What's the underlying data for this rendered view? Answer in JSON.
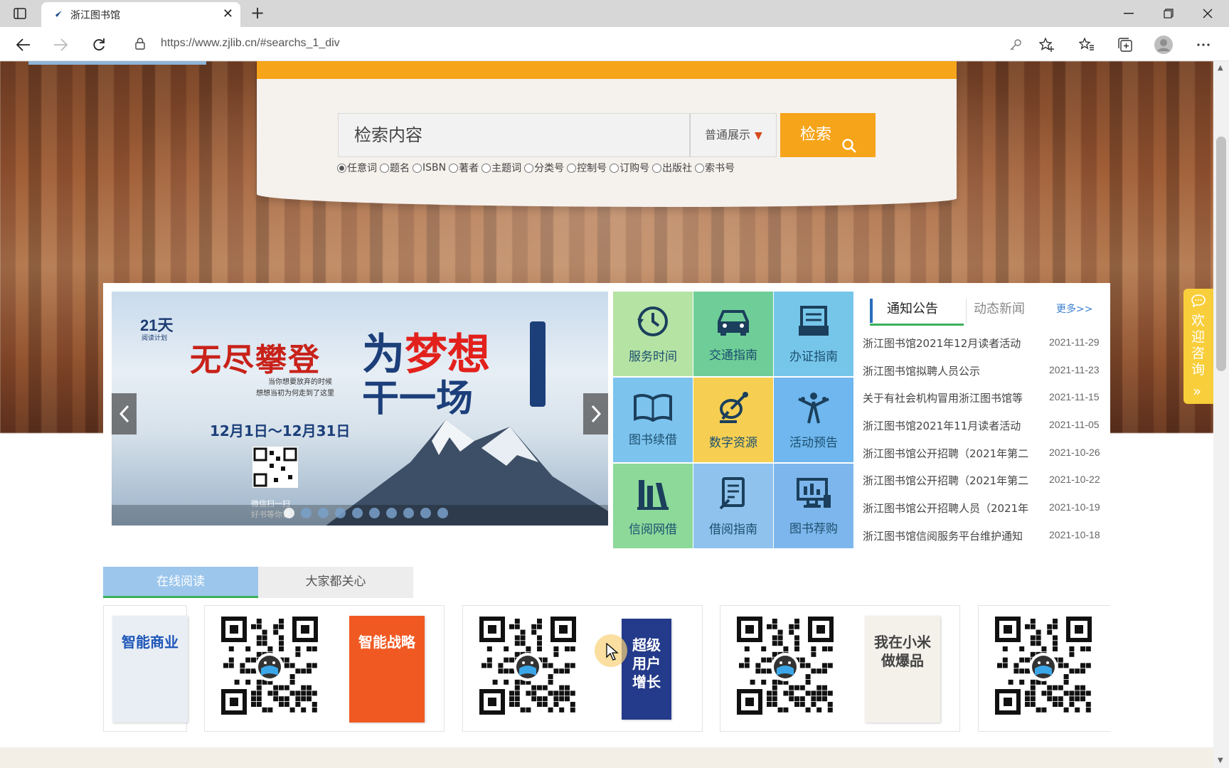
{
  "browser": {
    "tab_title": "浙江图书馆",
    "url": "https://www.zjlib.cn/#searchs_1_div",
    "tab_close": "✕",
    "new_tab": "+"
  },
  "search": {
    "placeholder": "检索内容",
    "display_mode": "普通展示",
    "button_label": "检索",
    "fields": [
      {
        "label": "任意词",
        "checked": true
      },
      {
        "label": "题名",
        "checked": false
      },
      {
        "label": "ISBN",
        "checked": false
      },
      {
        "label": "著者",
        "checked": false
      },
      {
        "label": "主题词",
        "checked": false
      },
      {
        "label": "分类号",
        "checked": false
      },
      {
        "label": "控制号",
        "checked": false
      },
      {
        "label": "订购号",
        "checked": false
      },
      {
        "label": "出版社",
        "checked": false
      },
      {
        "label": "索书号",
        "checked": false
      }
    ]
  },
  "banner": {
    "days": "21天",
    "plan": "阅读计划",
    "headline1": "无尽攀登",
    "sub1": "当你想要放弃的时候",
    "sub2": "想想当初为何走到了这里",
    "headline2a_pre": "为",
    "headline2a_accent": "梦想",
    "headline2b": "干一场",
    "date_range": "12月1日～12月31日",
    "qr_caption1": "微信扫一扫",
    "qr_caption2": "好书等你读",
    "slide_count": 10,
    "active_slide": 1
  },
  "tiles": [
    {
      "label": "服务时间",
      "icon": "clock-icon",
      "color": "#b5e3a4"
    },
    {
      "label": "交通指南",
      "icon": "car-icon",
      "color": "#6fce98"
    },
    {
      "label": "办证指南",
      "icon": "card-icon",
      "color": "#76c6ea"
    },
    {
      "label": "图书续借",
      "icon": "book-icon",
      "color": "#7cc3ee"
    },
    {
      "label": "数字资源",
      "icon": "satellite-icon",
      "color": "#f6cf52"
    },
    {
      "label": "活动预告",
      "icon": "people-icon",
      "color": "#6fb7ee"
    },
    {
      "label": "信阅网借",
      "icon": "books-icon",
      "color": "#8cd99a"
    },
    {
      "label": "借阅指南",
      "icon": "document-icon",
      "color": "#8fc3ee"
    },
    {
      "label": "图书荐购",
      "icon": "computer-icon",
      "color": "#7db6ec"
    }
  ],
  "news": {
    "tab_active": "通知公告",
    "tab_inactive": "动态新闻",
    "more": "更多>>",
    "items": [
      {
        "title": "浙江图书馆2021年12月读者活动",
        "date": "2021-11-29"
      },
      {
        "title": "浙江图书馆拟聘人员公示",
        "date": "2021-11-23"
      },
      {
        "title": "关于有社会机构冒用浙江图书馆等",
        "date": "2021-11-15"
      },
      {
        "title": "浙江图书馆2021年11月读者活动",
        "date": "2021-11-05"
      },
      {
        "title": "浙江图书馆公开招聘（2021年第二",
        "date": "2021-10-26"
      },
      {
        "title": "浙江图书馆公开招聘（2021年第二",
        "date": "2021-10-22"
      },
      {
        "title": "浙江图书馆公开招聘人员（2021年",
        "date": "2021-10-19"
      },
      {
        "title": "浙江图书馆信阅服务平台维护通知",
        "date": "2021-10-18"
      }
    ]
  },
  "consult": {
    "label": "欢迎咨询",
    "arrow": "»"
  },
  "lower": {
    "tab_active": "在线阅读",
    "tab_inactive": "大家都关心"
  },
  "books": [
    {
      "title": "智能商业",
      "color": "#e9eef4",
      "ink": "#1e56b8"
    },
    {
      "title": "智能战略",
      "color": "#f05a22",
      "ink": "#ffffff"
    },
    {
      "title": "超级用户增长",
      "color": "#243a8a",
      "ink": "#ffffff"
    },
    {
      "title": "我在小米做爆品",
      "color": "#f4f1ea",
      "ink": "#444444"
    }
  ],
  "colors": {
    "accent": "#f6a41a",
    "link": "#3a7fd0",
    "tab_blue": "#9cc6ec",
    "green_underline": "#3bb05a"
  }
}
